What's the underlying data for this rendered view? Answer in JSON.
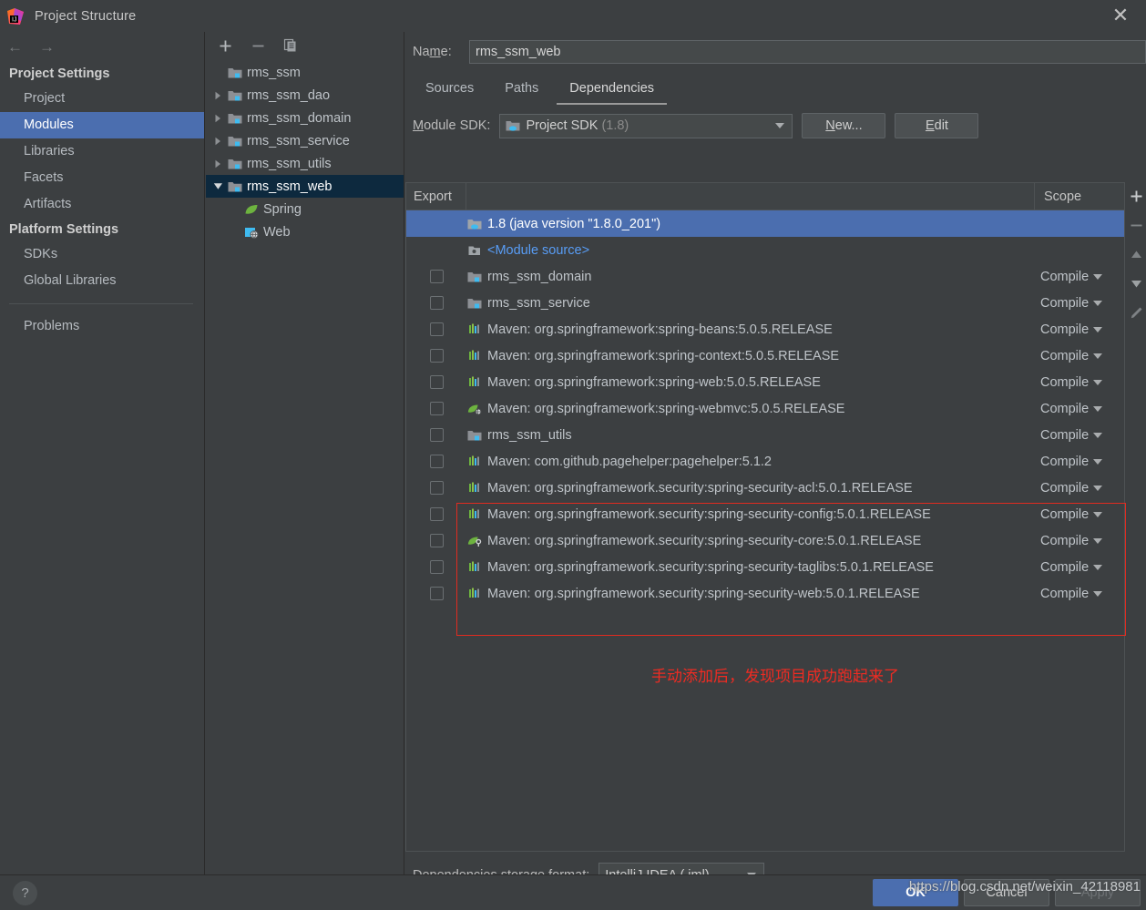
{
  "window": {
    "title": "Project Structure",
    "app_icon": "intellij-idea-logo",
    "close_label": "✕"
  },
  "sidebar": {
    "nav": {
      "back": "←",
      "forward": "→"
    },
    "groups": [
      {
        "title": "Project Settings",
        "items": [
          {
            "label": "Project",
            "selected": false
          },
          {
            "label": "Modules",
            "selected": true
          },
          {
            "label": "Libraries",
            "selected": false
          },
          {
            "label": "Facets",
            "selected": false
          },
          {
            "label": "Artifacts",
            "selected": false
          }
        ]
      },
      {
        "title": "Platform Settings",
        "items": [
          {
            "label": "SDKs",
            "selected": false
          },
          {
            "label": "Global Libraries",
            "selected": false
          }
        ]
      }
    ],
    "footer_items": [
      {
        "label": "Problems",
        "selected": false
      }
    ]
  },
  "module_tree": {
    "toolbar": [
      {
        "name": "add-module-icon",
        "glyph": "+"
      },
      {
        "name": "remove-module-icon",
        "glyph": "−"
      },
      {
        "name": "copy-module-icon",
        "glyph": "copy"
      }
    ],
    "nodes": [
      {
        "label": "rms_ssm",
        "icon": "module-folder-icon",
        "twisty": "none",
        "indent": 0,
        "selected": false
      },
      {
        "label": "rms_ssm_dao",
        "icon": "module-folder-icon",
        "twisty": "collapsed",
        "indent": 0,
        "selected": false
      },
      {
        "label": "rms_ssm_domain",
        "icon": "module-folder-icon",
        "twisty": "collapsed",
        "indent": 0,
        "selected": false
      },
      {
        "label": "rms_ssm_service",
        "icon": "module-folder-icon",
        "twisty": "collapsed",
        "indent": 0,
        "selected": false
      },
      {
        "label": "rms_ssm_utils",
        "icon": "module-folder-icon",
        "twisty": "collapsed",
        "indent": 0,
        "selected": false
      },
      {
        "label": "rms_ssm_web",
        "icon": "module-folder-icon",
        "twisty": "expanded",
        "indent": 0,
        "selected": true
      },
      {
        "label": "Spring",
        "icon": "spring-leaf-icon",
        "twisty": "none",
        "indent": 1,
        "selected": false
      },
      {
        "label": "Web",
        "icon": "web-facet-icon",
        "twisty": "none",
        "indent": 1,
        "selected": false
      }
    ]
  },
  "main": {
    "name_field": {
      "label": "Name:",
      "label_mnemonic": "m",
      "value": "rms_ssm_web"
    },
    "tabs": [
      {
        "label": "Sources",
        "active": false
      },
      {
        "label": "Paths",
        "active": false
      },
      {
        "label": "Dependencies",
        "active": true
      }
    ],
    "sdk_row": {
      "label": "Module SDK:",
      "value": "Project SDK",
      "value_detail": "(1.8)",
      "icon": "jdk-folder-icon",
      "new_button": "New...",
      "edit_button": "Edit"
    },
    "table": {
      "columns": [
        {
          "key": "export",
          "label": "Export"
        },
        {
          "key": "name",
          "label": ""
        },
        {
          "key": "scope",
          "label": "Scope"
        }
      ],
      "rows": [
        {
          "name": "1.8 (java version \"1.8.0_201\")",
          "icon": "jdk-folder-icon",
          "checkbox": null,
          "scope": "",
          "selected": true,
          "highlighted": false,
          "module_source": false
        },
        {
          "name": "<Module source>",
          "icon": "module-source-icon",
          "checkbox": null,
          "scope": "",
          "selected": false,
          "highlighted": false,
          "module_source": true
        },
        {
          "name": "rms_ssm_domain",
          "icon": "module-folder-icon",
          "checkbox": false,
          "scope": "Compile",
          "selected": false,
          "highlighted": false,
          "module_source": false
        },
        {
          "name": "rms_ssm_service",
          "icon": "module-folder-icon",
          "checkbox": false,
          "scope": "Compile",
          "selected": false,
          "highlighted": false,
          "module_source": false
        },
        {
          "name": "Maven: org.springframework:spring-beans:5.0.5.RELEASE",
          "icon": "maven-library-icon",
          "checkbox": false,
          "scope": "Compile",
          "selected": false,
          "highlighted": false,
          "module_source": false
        },
        {
          "name": "Maven: org.springframework:spring-context:5.0.5.RELEASE",
          "icon": "maven-library-icon",
          "checkbox": false,
          "scope": "Compile",
          "selected": false,
          "highlighted": false,
          "module_source": false
        },
        {
          "name": "Maven: org.springframework:spring-web:5.0.5.RELEASE",
          "icon": "maven-library-icon",
          "checkbox": false,
          "scope": "Compile",
          "selected": false,
          "highlighted": false,
          "module_source": false
        },
        {
          "name": "Maven: org.springframework:spring-webmvc:5.0.5.RELEASE",
          "icon": "spring-library-icon",
          "checkbox": false,
          "scope": "Compile",
          "selected": false,
          "highlighted": false,
          "module_source": false
        },
        {
          "name": "rms_ssm_utils",
          "icon": "module-folder-icon",
          "checkbox": false,
          "scope": "Compile",
          "selected": false,
          "highlighted": false,
          "module_source": false
        },
        {
          "name": "Maven: com.github.pagehelper:pagehelper:5.1.2",
          "icon": "maven-library-icon",
          "checkbox": false,
          "scope": "Compile",
          "selected": false,
          "highlighted": false,
          "module_source": false
        },
        {
          "name": "Maven: org.springframework.security:spring-security-acl:5.0.1.RELEASE",
          "icon": "maven-library-icon",
          "checkbox": false,
          "scope": "Compile",
          "selected": false,
          "highlighted": true,
          "module_source": false
        },
        {
          "name": "Maven: org.springframework.security:spring-security-config:5.0.1.RELEASE",
          "icon": "maven-library-icon",
          "checkbox": false,
          "scope": "Compile",
          "selected": false,
          "highlighted": true,
          "module_source": false
        },
        {
          "name": "Maven: org.springframework.security:spring-security-core:5.0.1.RELEASE",
          "icon": "spring-security-library-icon",
          "checkbox": false,
          "scope": "Compile",
          "selected": false,
          "highlighted": true,
          "module_source": false
        },
        {
          "name": "Maven: org.springframework.security:spring-security-taglibs:5.0.1.RELEASE",
          "icon": "maven-library-icon",
          "checkbox": false,
          "scope": "Compile",
          "selected": false,
          "highlighted": true,
          "module_source": false
        },
        {
          "name": "Maven: org.springframework.security:spring-security-web:5.0.1.RELEASE",
          "icon": "maven-library-icon",
          "checkbox": false,
          "scope": "Compile",
          "selected": false,
          "highlighted": true,
          "module_source": false
        }
      ]
    },
    "annotation": {
      "text": "手动添加后，发现项目成功跑起来了",
      "color": "#ef2b22"
    },
    "side_toolbar": [
      {
        "name": "add-dependency-icon",
        "glyph": "+"
      },
      {
        "name": "remove-dependency-icon",
        "glyph": "−"
      },
      {
        "name": "move-up-icon",
        "glyph": "▲"
      },
      {
        "name": "move-down-icon",
        "glyph": "▼"
      },
      {
        "name": "edit-dependency-icon",
        "glyph": "pencil"
      }
    ],
    "storage_row": {
      "label": "Dependencies storage format:",
      "value": "IntelliJ IDEA (.iml)"
    }
  },
  "bottom": {
    "help_label": "?",
    "ok_label": "OK",
    "cancel_label": "Cancel",
    "apply_label": "Apply",
    "watermark": "https://blog.csdn.net/weixin_42118981"
  },
  "colors": {
    "selection_blue": "#4b6eaf",
    "tree_selection": "#0d293e",
    "link_blue": "#589df6",
    "annotation_red": "#ef2b22",
    "background": "#3c3f41"
  }
}
